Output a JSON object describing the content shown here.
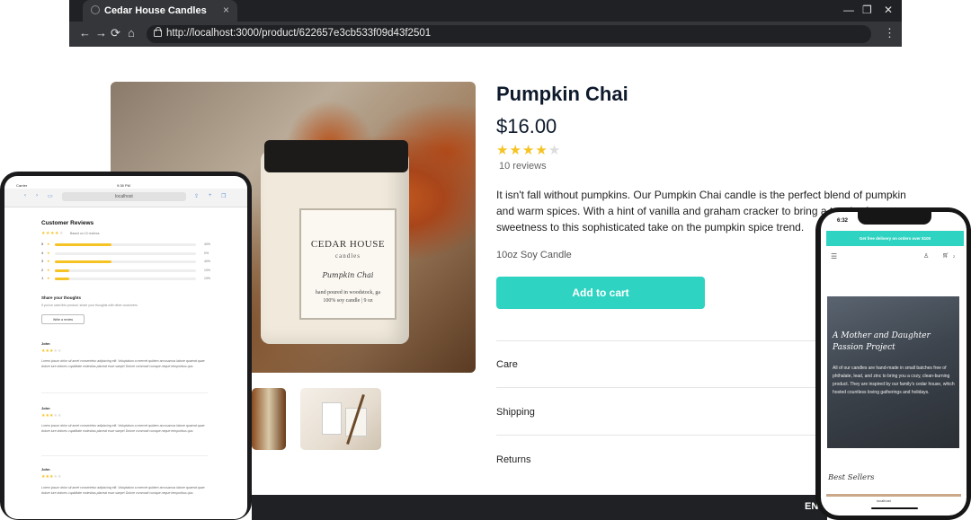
{
  "browser": {
    "tab_title": "Cedar House Candles",
    "url": "http://localhost:3000/product/622657e3cb533f09d43f2501",
    "close_glyph": "×",
    "minimize_glyph": "—",
    "restore_glyph": "❐",
    "window_close_glyph": "✕",
    "back_glyph": "←",
    "forward_glyph": "→",
    "reload_glyph": "⟳",
    "home_glyph": "⌂",
    "menu_glyph": "⋮"
  },
  "product": {
    "title": "Pumpkin Chai",
    "price": "$16.00",
    "rating": 4,
    "rating_max": 5,
    "reviews_label": "10 reviews",
    "description": "It isn't fall without pumpkins. Our Pumpkin Chai candle is the perfect blend of pumpkin and warm spices. With a hint of vanilla and graham cracker to bring a touch of sweetness to this sophisticated take on the pumpkin spice trend.",
    "variant": "10oz Soy Candle",
    "add_to_cart": "Add to cart",
    "accordion": [
      "Care",
      "Shipping",
      "Returns"
    ],
    "jar_label": {
      "brand": "CEDAR HOUSE",
      "sub": "candles",
      "scent": "Pumpkin Chai",
      "info1": "hand poured in woodstock, ga",
      "info2": "100% soy candle | 9 oz"
    }
  },
  "footer": {
    "language": "ENG"
  },
  "tablet": {
    "status_left": "Carrier",
    "time": "9:38 PM",
    "url": "localhost",
    "heading": "Customer Reviews",
    "based_on": "Based on 10 reviews",
    "breakdown": [
      {
        "stars": "5",
        "pct_label": "40%",
        "fraction": 0.4
      },
      {
        "stars": "4",
        "pct_label": "0%",
        "fraction": 0.0
      },
      {
        "stars": "3",
        "pct_label": "40%",
        "fraction": 0.4
      },
      {
        "stars": "2",
        "pct_label": "10%",
        "fraction": 0.1
      },
      {
        "stars": "1",
        "pct_label": "10%",
        "fraction": 0.1
      }
    ],
    "share_heading": "Share your thoughts",
    "share_sub": "If you've used this product, share your thoughts with other customers",
    "write_button": "Write a review",
    "reviews": [
      {
        "name": "John",
        "text": "Lorem ipsum dolor sit amet consectetur adipiscing elit. Voluptatum a exercet quidem accusamus labore quaerat quae dolore iure dolores cupiditate molestias placeat esse saepe! Dolore commodi cumque neque temporibus quo."
      },
      {
        "name": "John",
        "text": "Lorem ipsum dolor sit amet consectetur adipiscing elit. Voluptatum a exercet quidem accusamus labore quaerat quae dolore iure dolores cupiditate molestias placeat esse saepe! Dolore commodi cumque neque temporibus quo."
      },
      {
        "name": "John",
        "text": "Lorem ipsum dolor sit amet consectetur adipiscing elit. Voluptatum a exercet quidem accusamus labore quaerat quae dolore iure dolores cupiditate molestias placeat esse saepe! Dolore commodi cumque neque temporibus quo."
      }
    ]
  },
  "phone": {
    "time": "6:32",
    "banner": "Get free delivery on orders over $100",
    "cart_count": "2",
    "hero_title": "A Mother and Daughter Passion Project",
    "hero_text": "All of our candles are hand-made in small batches free of phthalate, lead, and zinc to bring you a cozy, clean-burning product. They are inspired by our family's cedar house, which hosted countless loving gatherings and holidays.",
    "best_sellers": "Best Sellers",
    "url": "localhost"
  },
  "colors": {
    "accent": "#2fd3c1",
    "star": "#f6c324",
    "dark": "#0e1a2b"
  },
  "icons": {
    "menu": "hamburger-icon",
    "user": "user-icon",
    "cart": "cart-icon",
    "lock": "lock-icon"
  }
}
